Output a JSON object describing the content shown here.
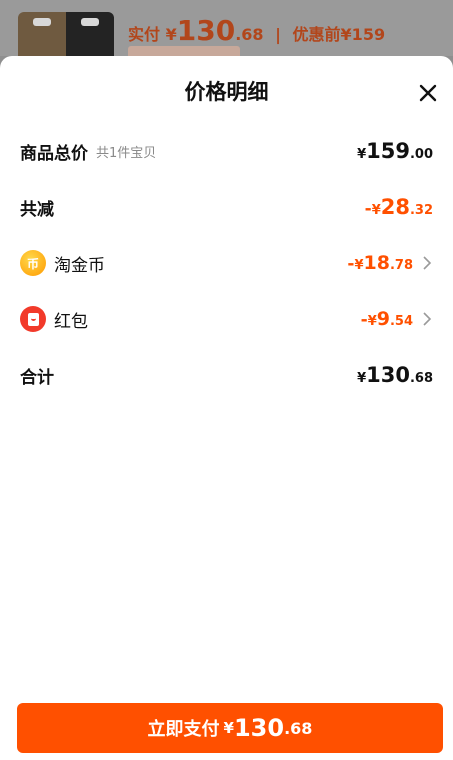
{
  "background": {
    "paid_label": "实付",
    "currency": "¥",
    "paid_int": "130",
    "paid_dec": ".68",
    "separator": "|",
    "before_label": "优惠前",
    "before_amount": "¥159"
  },
  "sheet": {
    "title": "价格明细",
    "close_icon": "close-icon"
  },
  "rows": {
    "total": {
      "label": "商品总价",
      "sub": "共1件宝贝",
      "currency": "¥",
      "int": "159",
      "dec": ".00"
    },
    "reduce": {
      "label": "共减",
      "prefix": "-",
      "currency": "¥",
      "int": "28",
      "dec": ".32"
    },
    "coin": {
      "label": "淘金币",
      "icon_char": "币",
      "icon": "taojinbi-coin-icon",
      "prefix": "-",
      "currency": "¥",
      "int": "18",
      "dec": ".78"
    },
    "redpacket": {
      "label": "红包",
      "icon": "red-packet-icon",
      "prefix": "-",
      "currency": "¥",
      "int": "9",
      "dec": ".54"
    },
    "sum": {
      "label": "合计",
      "currency": "¥",
      "int": "130",
      "dec": ".68"
    }
  },
  "pay_button": {
    "label": "立即支付",
    "currency": "¥",
    "int": "130",
    "dec": ".68"
  },
  "colors": {
    "accent": "#ff5000",
    "text": "#111111",
    "muted": "#8a8a8a"
  }
}
